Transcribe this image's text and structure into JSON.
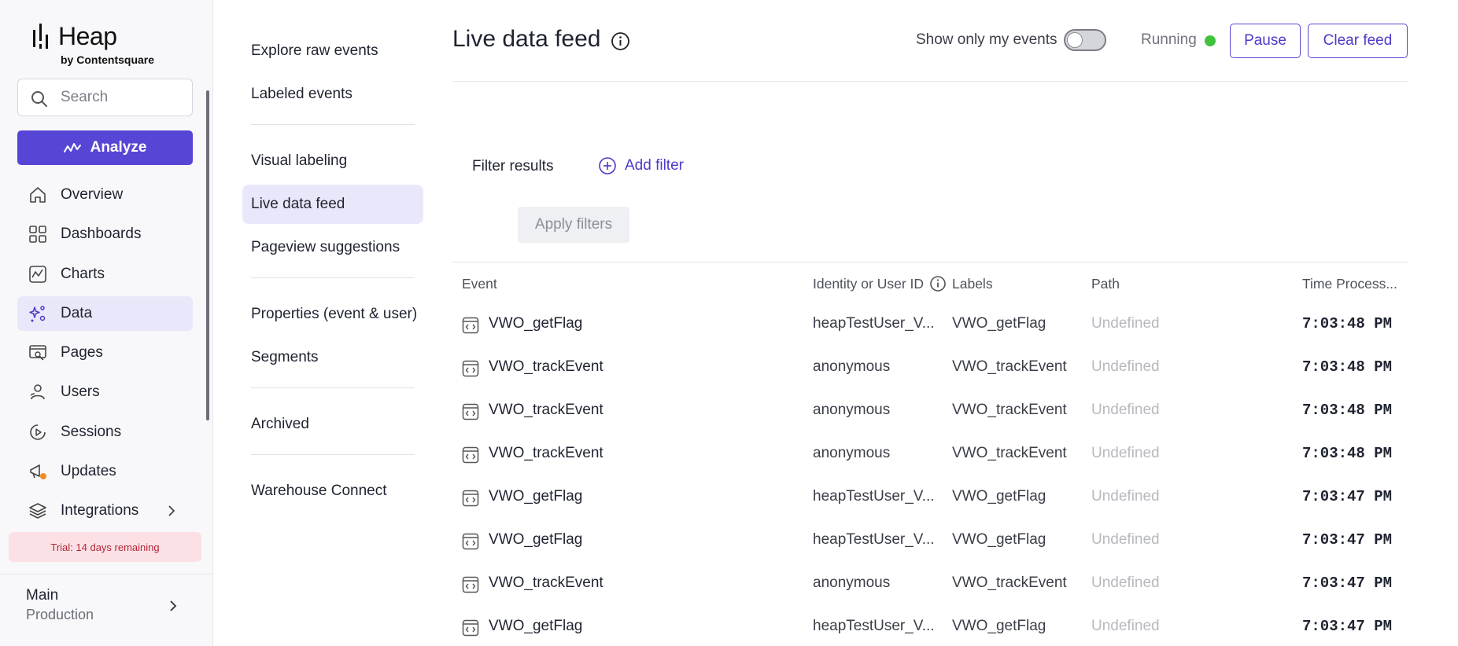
{
  "brand": {
    "name": "Heap",
    "subtitle": "by Contentsquare"
  },
  "search": {
    "placeholder": "Search",
    "value": ""
  },
  "analyze_button": {
    "label": "Analyze"
  },
  "sidebar": {
    "items": [
      {
        "label": "Overview",
        "icon": "home-icon"
      },
      {
        "label": "Dashboards",
        "icon": "dashboard-icon"
      },
      {
        "label": "Charts",
        "icon": "chart-icon"
      },
      {
        "label": "Data",
        "icon": "data-sparkle-icon",
        "active": true
      },
      {
        "label": "Pages",
        "icon": "pages-icon"
      },
      {
        "label": "Users",
        "icon": "users-icon"
      },
      {
        "label": "Sessions",
        "icon": "sessions-icon"
      },
      {
        "label": "Updates",
        "icon": "megaphone-icon"
      },
      {
        "label": "Integrations",
        "icon": "layers-icon"
      }
    ],
    "trial_text": "Trial: 14 days remaining",
    "environment": {
      "name": "Main",
      "subtitle": "Production"
    }
  },
  "subnav": {
    "groups": [
      [
        "Explore raw events",
        "Labeled events"
      ],
      [
        "Visual labeling",
        "Live data feed",
        "Pageview suggestions"
      ],
      [
        "Properties (event & user)",
        "Segments"
      ],
      [
        "Archived"
      ],
      [
        "Warehouse Connect"
      ]
    ],
    "active": "Live data feed"
  },
  "header": {
    "title": "Live data feed",
    "toggle_label": "Show only my events",
    "toggle_on": false,
    "status": "Running",
    "status_color": "#41c23f",
    "pause_label": "Pause",
    "clear_label": "Clear feed"
  },
  "filters": {
    "label": "Filter results",
    "add_label": "Add filter",
    "apply_label": "Apply filters"
  },
  "table": {
    "columns": [
      "Event",
      "Identity or User ID",
      "Labels",
      "Path",
      "Time Process..."
    ],
    "rows": [
      {
        "event": "VWO_getFlag",
        "identity": "heapTestUser_V...",
        "label": "VWO_getFlag",
        "path": "Undefined",
        "time": "7:03:48 PM"
      },
      {
        "event": "VWO_trackEvent",
        "identity": "anonymous",
        "label": "VWO_trackEvent",
        "path": "Undefined",
        "time": "7:03:48 PM"
      },
      {
        "event": "VWO_trackEvent",
        "identity": "anonymous",
        "label": "VWO_trackEvent",
        "path": "Undefined",
        "time": "7:03:48 PM"
      },
      {
        "event": "VWO_trackEvent",
        "identity": "anonymous",
        "label": "VWO_trackEvent",
        "path": "Undefined",
        "time": "7:03:48 PM"
      },
      {
        "event": "VWO_getFlag",
        "identity": "heapTestUser_V...",
        "label": "VWO_getFlag",
        "path": "Undefined",
        "time": "7:03:47 PM"
      },
      {
        "event": "VWO_getFlag",
        "identity": "heapTestUser_V...",
        "label": "VWO_getFlag",
        "path": "Undefined",
        "time": "7:03:47 PM"
      },
      {
        "event": "VWO_trackEvent",
        "identity": "anonymous",
        "label": "VWO_trackEvent",
        "path": "Undefined",
        "time": "7:03:47 PM"
      },
      {
        "event": "VWO_getFlag",
        "identity": "heapTestUser_V...",
        "label": "VWO_getFlag",
        "path": "Undefined",
        "time": "7:03:47 PM"
      }
    ]
  }
}
